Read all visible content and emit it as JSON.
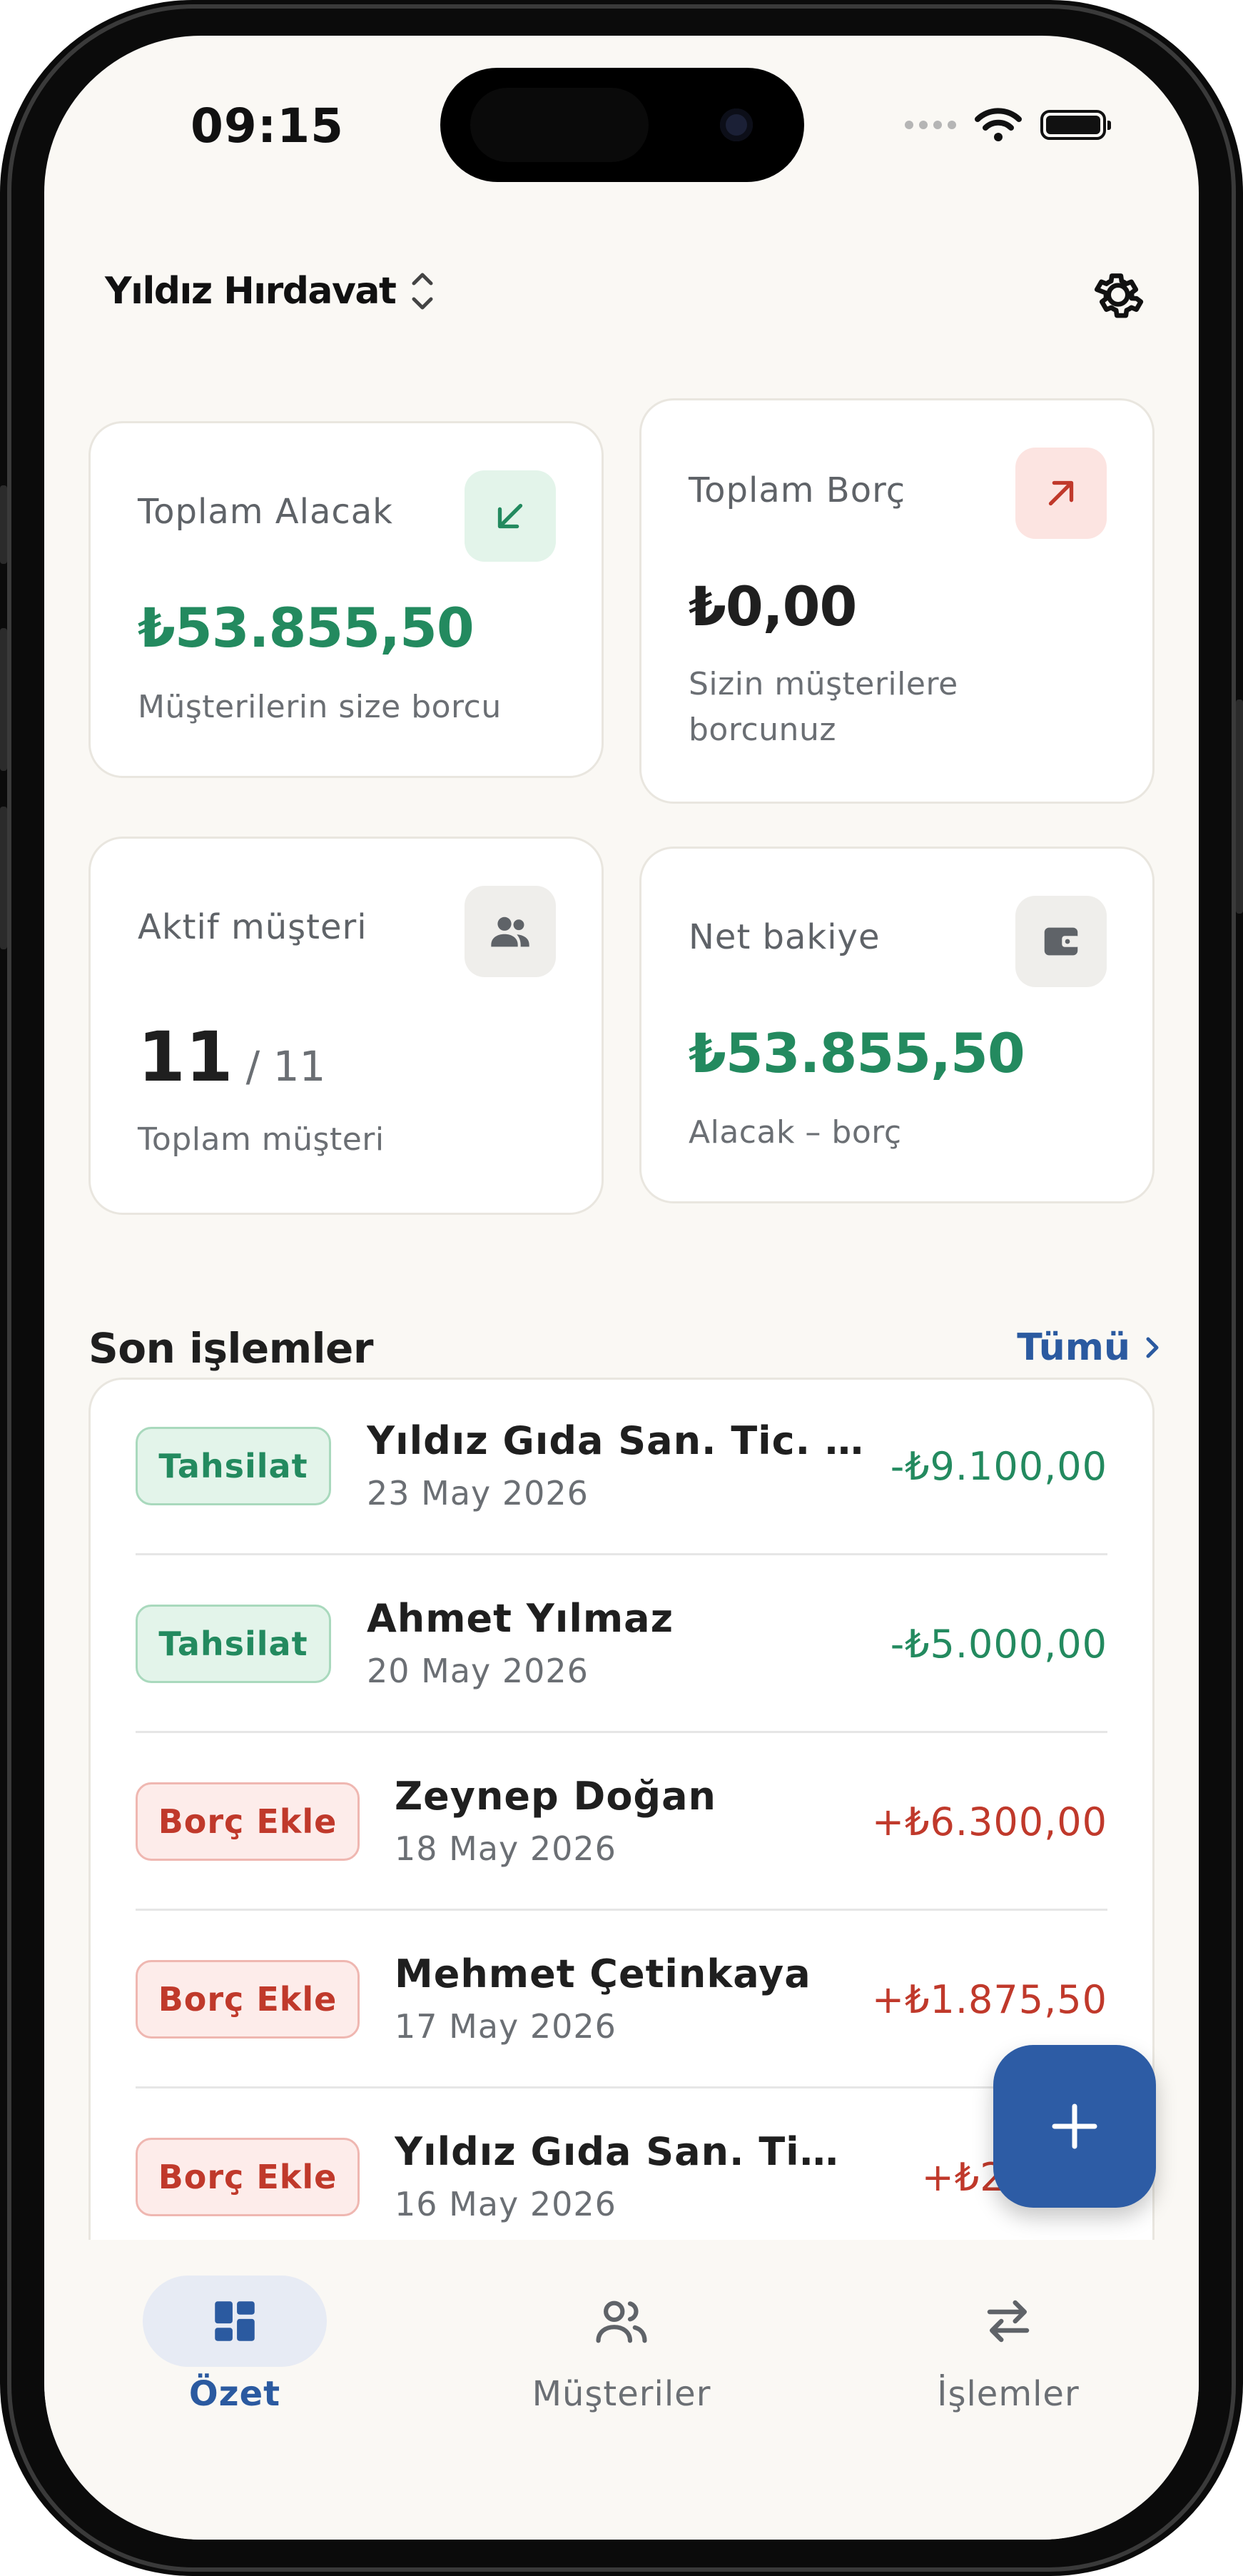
{
  "status_bar": {
    "time": "09:15"
  },
  "header": {
    "business_name": "Yıldız Hırdavat"
  },
  "cards": {
    "receivable": {
      "label": "Toplam Alacak",
      "amount": "₺53.855,50",
      "sub": "Müşterilerin size borcu",
      "icon": "arrow-down-left-icon"
    },
    "payable": {
      "label": "Toplam Borç",
      "amount": "₺0,00",
      "sub": "Sizin müşterilere borcunuz",
      "icon": "arrow-up-right-icon"
    },
    "active_customers": {
      "label": "Aktif müşteri",
      "count": "11",
      "total": "/ 11",
      "sub": "Toplam müşteri",
      "icon": "people-icon"
    },
    "net_balance": {
      "label": "Net bakiye",
      "amount": "₺53.855,50",
      "sub": "Alacak – borç",
      "icon": "wallet-icon"
    }
  },
  "recent": {
    "title": "Son işlemler",
    "see_all": "Tümü",
    "transactions": [
      {
        "type": "Tahsilat",
        "kind": "collect",
        "customer": "Yıldız Gıda San. Tic. A....",
        "date": "23 May 2026",
        "amount": "-₺9.100,00"
      },
      {
        "type": "Tahsilat",
        "kind": "collect",
        "customer": "Ahmet Yılmaz",
        "date": "20 May 2026",
        "amount": "-₺5.000,00"
      },
      {
        "type": "Borç Ekle",
        "kind": "debt",
        "customer": "Zeynep Doğan",
        "date": "18 May 2026",
        "amount": "+₺6.300,00"
      },
      {
        "type": "Borç Ekle",
        "kind": "debt",
        "customer": "Mehmet Çetinkaya",
        "date": "17 May 2026",
        "amount": "+₺1.875,50"
      },
      {
        "type": "Borç Ekle",
        "kind": "debt",
        "customer": "Yıldız Gıda San. Tic...",
        "date": "16 May 2026",
        "amount": "+₺22.6..."
      }
    ]
  },
  "nav": {
    "summary": "Özet",
    "customers": "Müşteriler",
    "transactions": "İşlemler",
    "active": "summary"
  },
  "colors": {
    "accent": "#2d5ca5",
    "positive": "#238a5f",
    "negative": "#c0392b"
  }
}
